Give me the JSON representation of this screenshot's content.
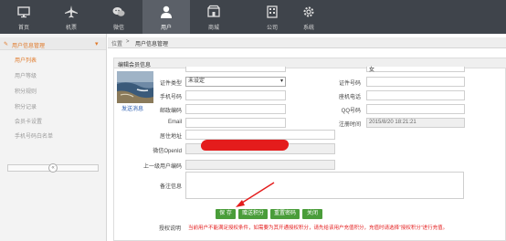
{
  "nav": [
    {
      "label": "首页",
      "icon": "monitor-icon"
    },
    {
      "label": "机票",
      "icon": "plane-icon"
    },
    {
      "label": "微信",
      "icon": "wechat-icon"
    },
    {
      "label": "用户",
      "icon": "user-icon",
      "active": true
    },
    {
      "label": "商城",
      "icon": "shop-icon"
    },
    {
      "label": "公司",
      "icon": "company-icon"
    },
    {
      "label": "系统",
      "icon": "gear-icon"
    }
  ],
  "sidebar": {
    "header": "用户信息管理",
    "items": [
      {
        "label": "用户列表",
        "selected": true
      },
      {
        "label": "用户等级"
      },
      {
        "label": "积分规则"
      },
      {
        "label": "积分记录"
      },
      {
        "label": "会员卡设置"
      },
      {
        "label": "手机号码白名单"
      }
    ],
    "collapse_icon": "«"
  },
  "breadcrumb": {
    "home": "位置",
    "sep": ">",
    "current": "用户信息管理"
  },
  "panel": {
    "title": "编辑会员信息",
    "send_message": "发送消息",
    "fields": {
      "cert_type_label": "证件类型",
      "cert_type_value": "未设定",
      "cert_no_label": "证件号码",
      "mobile_label": "手机号码",
      "landline_label": "座机电话",
      "postcode_label": "邮政编码",
      "qq_label": "QQ号码",
      "email_label": "Email",
      "reg_time_label": "注册时间",
      "reg_time_value": "2015/8/20 18:21:21",
      "address_label": "居住地址",
      "openid_label": "微信OpenId",
      "parent_code_label": "上一级用户编码",
      "remark_label": "备注信息",
      "gender_value": "女"
    },
    "buttons": {
      "save": "保 存",
      "add_points": "赠送积分",
      "reset_password": "重置密码",
      "close": "关闭"
    },
    "note_label": "授权说明",
    "note_text": "当前用户不能满足授权条件，如需要为其开通授权积分，请先给该用户充值积分，充值时请选择“授权积分”进行充值。"
  }
}
